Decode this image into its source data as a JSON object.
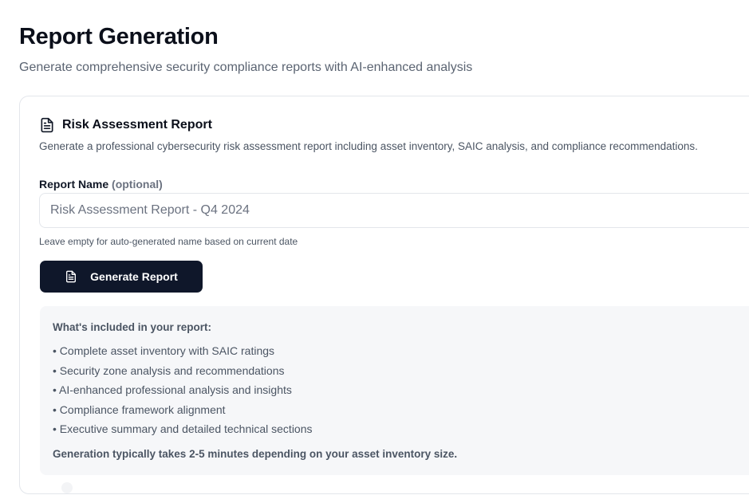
{
  "page": {
    "title": "Report Generation",
    "subtitle": "Generate comprehensive security compliance reports with AI-enhanced analysis"
  },
  "card": {
    "icon": "file-text-icon",
    "title": "Risk Assessment Report",
    "description": "Generate a professional cybersecurity risk assessment report including asset inventory, SAIC analysis, and compliance recommendations."
  },
  "form": {
    "label": "Report Name",
    "label_optional": "(optional)",
    "value": "",
    "placeholder": "Risk Assessment Report - Q4 2024",
    "help": "Leave empty for auto-generated name based on current date"
  },
  "button": {
    "icon": "file-text-icon",
    "label": "Generate Report"
  },
  "info": {
    "heading": "What's included in your report:",
    "items": [
      "• Complete asset inventory with SAIC ratings",
      "• Security zone analysis and recommendations",
      "• AI-enhanced professional analysis and insights",
      "• Compliance framework alignment",
      "• Executive summary and detailed technical sections"
    ],
    "footer": "Generation typically takes 2-5 minutes depending on your asset inventory size."
  },
  "colors": {
    "primary_button": "#0f172a",
    "panel_background": "#f6f7f9",
    "border": "#e3e6eb",
    "muted_text": "#4b5563"
  }
}
